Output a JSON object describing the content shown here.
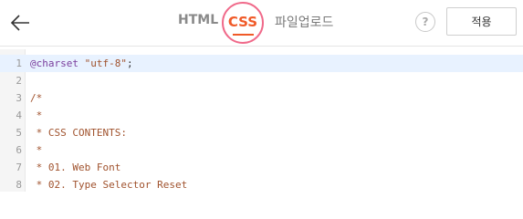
{
  "header": {
    "tabs": {
      "html": "HTML",
      "css": "CSS",
      "upload": "파일업로드"
    },
    "help_label": "?",
    "apply_label": "적용",
    "active_tab": "CSS",
    "colors": {
      "active": "#f05a28",
      "ring": "#f06a8a"
    }
  },
  "editor": {
    "active_line": 1,
    "lines": [
      {
        "num": "1",
        "keyword": "@charset",
        "string": " \"utf-8\"",
        "rest": ";"
      },
      {
        "num": "2",
        "text": ""
      },
      {
        "num": "3",
        "text": "/*"
      },
      {
        "num": "4",
        "text": " *"
      },
      {
        "num": "5",
        "text": " * CSS CONTENTS:"
      },
      {
        "num": "6",
        "text": " *"
      },
      {
        "num": "7",
        "text": " * 01. Web Font"
      },
      {
        "num": "8",
        "text": " * 02. Type Selector Reset"
      }
    ]
  }
}
